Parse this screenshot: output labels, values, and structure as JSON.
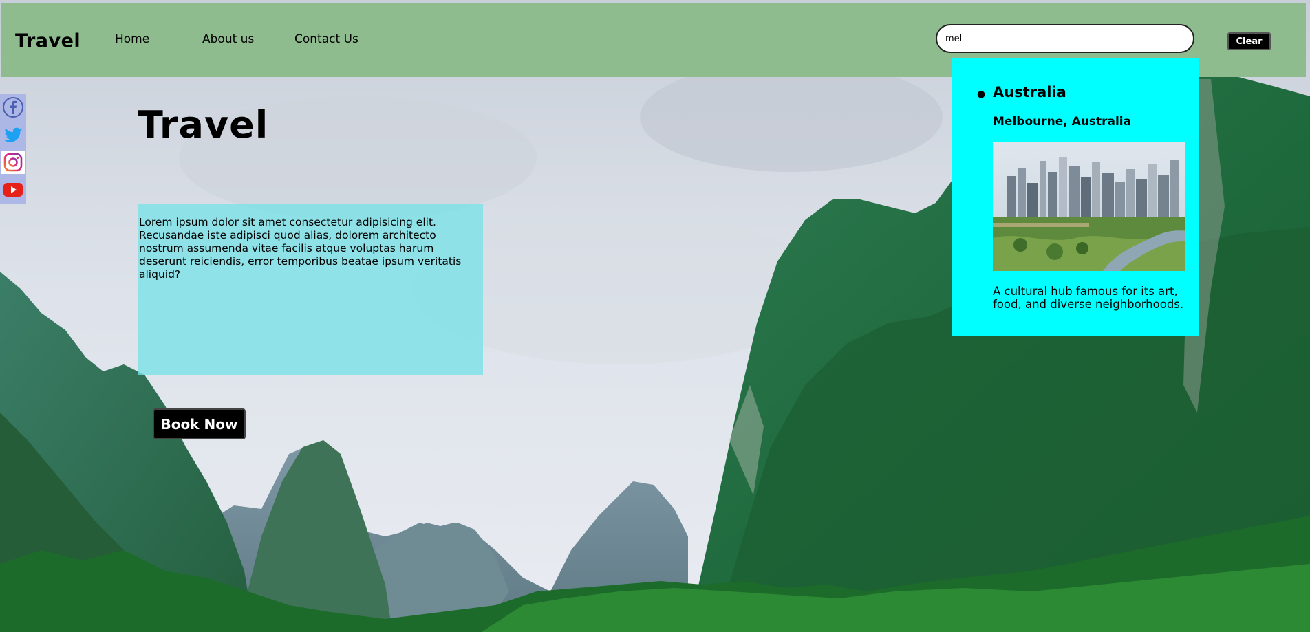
{
  "header": {
    "brand": "Travel",
    "nav": [
      {
        "label": "Home"
      },
      {
        "label": "About us"
      },
      {
        "label": "Contact Us"
      }
    ],
    "search": {
      "value": "mel",
      "placeholder": ""
    },
    "clear_label": "Clear"
  },
  "social": {
    "icons": [
      "facebook-icon",
      "twitter-icon",
      "instagram-icon",
      "youtube-icon"
    ]
  },
  "hero": {
    "title": "Travel",
    "text": "Lorem ipsum dolor sit amet consectetur adipisicing elit. Recusandae iste adipisci quod alias, dolorem architecto nostrum assumenda vitae facilis atque voluptas harum deserunt reiciendis, error temporibus beatae ipsum veritatis aliquid?",
    "book_label": "Book Now"
  },
  "results": {
    "items": [
      {
        "country": "Australia",
        "city": "Melbourne, Australia",
        "description": "A cultural hub famous for its art, food, and diverse neighborhoods."
      }
    ]
  },
  "colors": {
    "navbar": "#8fbc8f",
    "results_bg": "#00ffff",
    "info_box": "#7ae2e8",
    "button": "#000000"
  }
}
